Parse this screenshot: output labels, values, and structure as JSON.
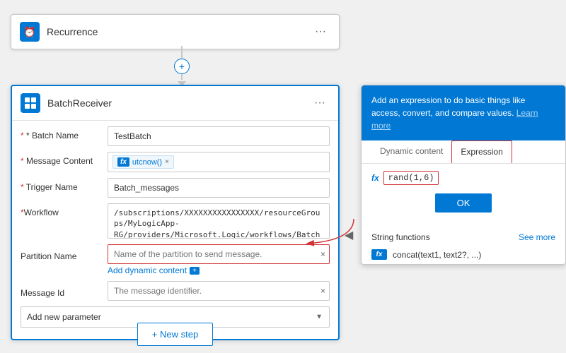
{
  "recurrence": {
    "title": "Recurrence",
    "icon": "⏰"
  },
  "connector": {
    "plus": "+"
  },
  "batch": {
    "title": "BatchReceiver",
    "icon": "⊞",
    "fields": {
      "batchName": {
        "label": "* Batch Name",
        "value": "TestBatch"
      },
      "messageContent": {
        "label": "* Message Content",
        "tokenFx": "fx",
        "tokenValue": "utcnow()"
      },
      "triggerName": {
        "label": "* Trigger Name",
        "value": "Batch_messages"
      },
      "workflow": {
        "label": "*Workflow",
        "value": "/subscriptions/XXXXXXXXXXXXXXXX/resourceGroups/MyLogicApp-RG/providers/Microsoft.Logic/workflows/BatchReceiver"
      },
      "partitionName": {
        "label": "Partition Name",
        "placeholder": "Name of the partition to send message."
      },
      "addDynamicContent": "Add dynamic content",
      "messageId": {
        "label": "Message Id",
        "placeholder": "The message identifier."
      },
      "addNewParam": {
        "label": "Add new parameter"
      }
    }
  },
  "newStep": {
    "label": "+ New step"
  },
  "popup": {
    "headerText": "Add an expression to do basic things like access, convert, and compare values.",
    "learnMoreText": "Learn more",
    "tabs": {
      "dynamic": "Dynamic content",
      "expression": "Expression"
    },
    "expressionValue": "rand(1,6)",
    "okLabel": "OK",
    "sections": {
      "stringFunctions": {
        "label": "String functions",
        "seeMore": "See more"
      },
      "funcItem": {
        "fx": "fx",
        "label": "concat(text1, text2?, ...)"
      }
    }
  }
}
